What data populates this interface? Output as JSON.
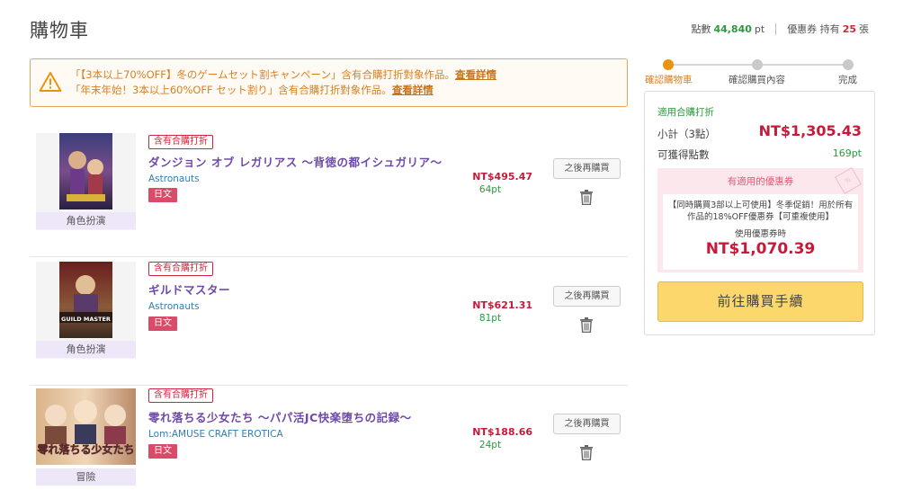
{
  "page": {
    "title": "購物車"
  },
  "header": {
    "points_label": "點數",
    "points_value": "44,840",
    "points_unit": "pt",
    "coupon_label": "優惠券 持有",
    "coupon_count": "25",
    "coupon_unit": "張"
  },
  "alert": {
    "lines": [
      {
        "text": "「【3本以上70%OFF】冬のゲームセット割キャンペーン」含有合購打折對象作品。",
        "link": "查看詳情"
      },
      {
        "text": "「年末年始！3本以上60%OFF セット割り」含有合購打折對象作品。",
        "link": "查看詳情"
      }
    ]
  },
  "items": [
    {
      "badge": "含有合購打折",
      "title": "ダンジョン オブ レガリアス ～背徳の都イシュガリア～",
      "maker": "Astronauts",
      "lang": "日文",
      "genre": "角色扮演",
      "price": "NT$495.47",
      "points": "64pt",
      "later": "之後再購買"
    },
    {
      "badge": "含有合購打折",
      "title": "ギルドマスター",
      "maker": "Astronauts",
      "lang": "日文",
      "genre": "角色扮演",
      "price": "NT$621.31",
      "points": "81pt",
      "later": "之後再購買",
      "cover_text": "GUILD MASTER"
    },
    {
      "badge": "含有合購打折",
      "title": "零れ落ちる少女たち ～パパ活JC快楽堕ちの記録～",
      "maker": "Lom:AMUSE CRAFT EROTICA",
      "lang": "日文",
      "genre": "冒險",
      "price": "NT$188.66",
      "points": "24pt",
      "later": "之後再購買",
      "cover_text": "零れ落ちる少女たち"
    }
  ],
  "steps": [
    {
      "label": "確認購物車",
      "active": true
    },
    {
      "label": "確認購買內容",
      "active": false
    },
    {
      "label": "完成",
      "active": false
    }
  ],
  "summary": {
    "applied": "適用合購打折",
    "subtotal_label": "小計（3點）",
    "subtotal_value": "NT$1,305.43",
    "earn_label": "可獲得點數",
    "earn_value": "169pt",
    "coupon_title": "有適用的優惠券",
    "coupon_desc": "【同時購買3部以上可使用】冬季促銷！用於所有作品的18%OFF優惠券【可重複使用】",
    "coupon_use_label": "使用優惠券時",
    "coupon_price": "NT$1,070.39",
    "checkout": "前往購買手續"
  },
  "colors": {
    "accent_orange": "#e8940e",
    "price_red": "#c9193a",
    "points_green": "#2a9a3c",
    "title_purple": "#6e4aa8",
    "checkout_yellow": "#fbd76c"
  },
  "icons": [
    "warning-icon",
    "trash-icon"
  ]
}
